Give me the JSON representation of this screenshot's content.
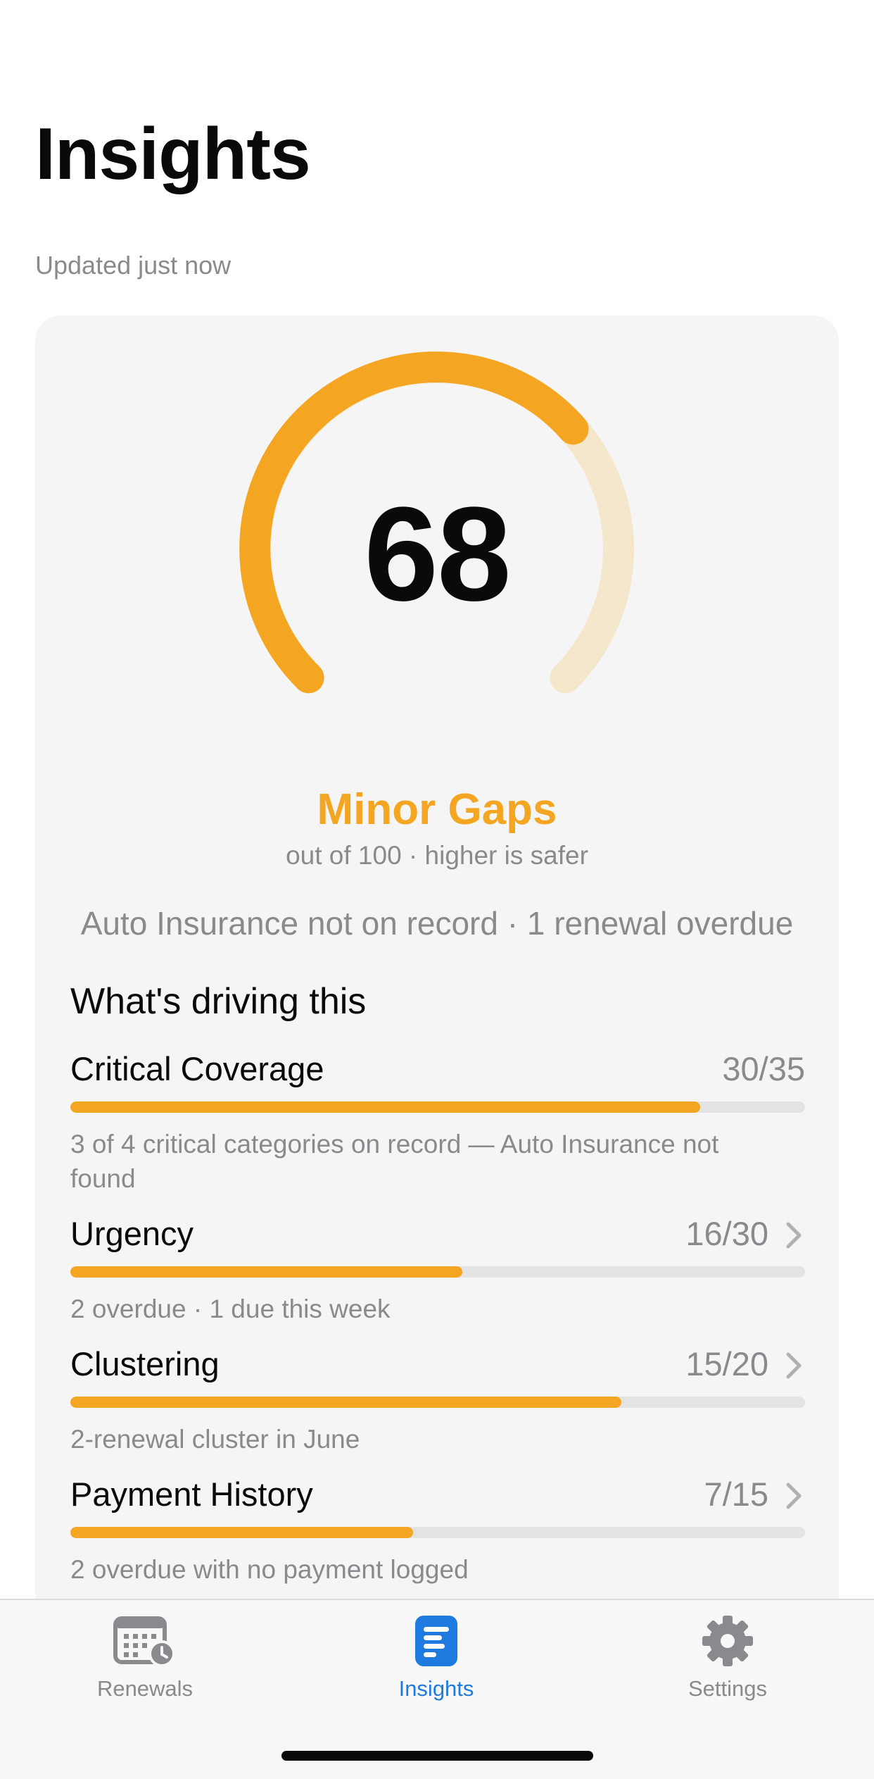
{
  "header": {
    "title": "Insights",
    "updated": "Updated just now"
  },
  "score_card": {
    "score": "68",
    "score_value": 68,
    "score_max": 100,
    "band": "Minor Gaps",
    "scale_note": "out of 100 · higher is safer",
    "summary": "Auto Insurance not on record · 1 renewal overdue",
    "colors": {
      "accent": "#f4a623",
      "track": "#f5e7cc"
    }
  },
  "drivers": {
    "heading": "What's driving this",
    "items": [
      {
        "name": "Critical Coverage",
        "score": "30/35",
        "value": 30,
        "max": 35,
        "note": "3 of 4 critical categories on record — Auto Insurance not found",
        "has_chevron": false
      },
      {
        "name": "Urgency",
        "score": "16/30",
        "value": 16,
        "max": 30,
        "note": "2 overdue · 1 due this week",
        "has_chevron": true
      },
      {
        "name": "Clustering",
        "score": "15/20",
        "value": 15,
        "max": 20,
        "note": "2-renewal cluster in June",
        "has_chevron": true
      },
      {
        "name": "Payment History",
        "score": "7/15",
        "value": 7,
        "max": 15,
        "note": "2 overdue with no payment logged",
        "has_chevron": true
      }
    ]
  },
  "tabbar": {
    "tabs": [
      {
        "label": "Renewals",
        "icon": "calendar-clock-icon",
        "active": false
      },
      {
        "label": "Insights",
        "icon": "insights-document-icon",
        "active": true
      },
      {
        "label": "Settings",
        "icon": "gear-icon",
        "active": false
      }
    ],
    "colors": {
      "active": "#1f7ae0",
      "inactive": "#8a8a8e"
    }
  }
}
